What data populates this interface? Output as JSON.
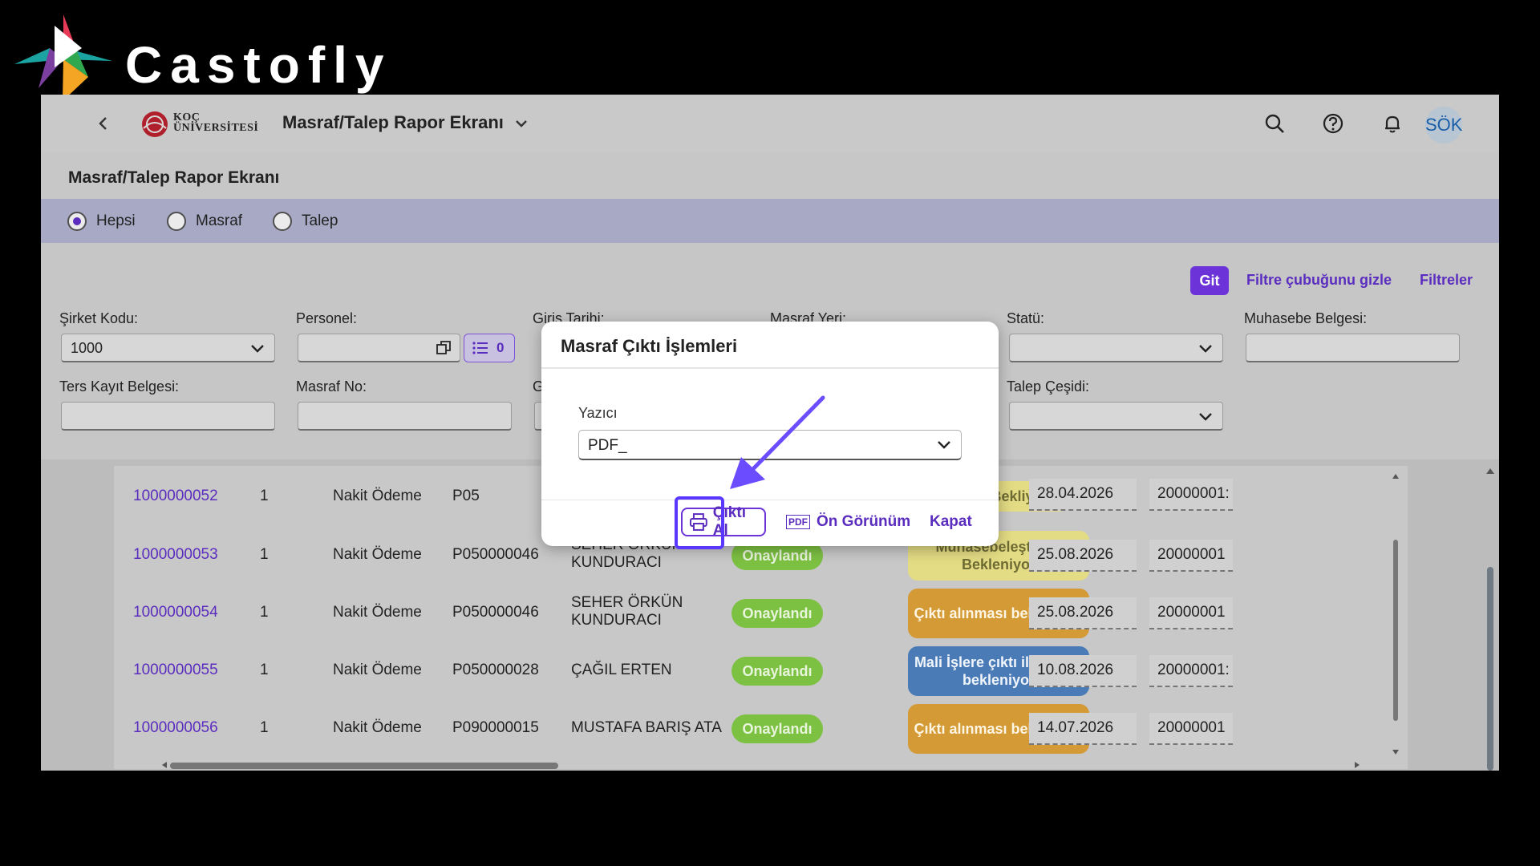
{
  "brand": {
    "name": "Castofly"
  },
  "shell": {
    "logo_line1": "KOÇ",
    "logo_line2": "ÜNİVERSİTESİ",
    "app_title": "Masraf/Talep Rapor Ekranı",
    "avatar": "SÖK",
    "icons": [
      "chevron-left-icon",
      "search-icon",
      "help-icon",
      "bell-icon"
    ]
  },
  "page": {
    "title": "Masraf/Talep Rapor Ekranı"
  },
  "radio": {
    "options": [
      {
        "label": "Hepsi",
        "selected": true
      },
      {
        "label": "Masraf",
        "selected": false
      },
      {
        "label": "Talep",
        "selected": false
      }
    ]
  },
  "filterbar": {
    "go": "Git",
    "hide": "Filtre çubuğunu gizle",
    "filters": "Filtreler",
    "fields": {
      "sirket_kodu": {
        "label": "Şirket Kodu:",
        "value": "1000"
      },
      "personel": {
        "label": "Personel:",
        "count": "0"
      },
      "giris_tarihi": {
        "label": "Giris Tarihi:"
      },
      "masraf_yeri": {
        "label": "Masraf Yeri:"
      },
      "statu": {
        "label": "Statü:"
      },
      "muhasebe_belgesi": {
        "label": "Muhasebe Belgesi:"
      },
      "ters_kayit": {
        "label": "Ters Kayıt Belgesi:"
      },
      "masraf_no": {
        "label": "Masraf No:"
      },
      "g_partial": {
        "label": "G"
      },
      "talep_cesidi": {
        "label": "Talep Çeşidi:"
      }
    }
  },
  "table": {
    "rows": [
      {
        "no": "1000000052",
        "qty": "1",
        "type": "Nakit Ödeme",
        "pcode": "P05",
        "name": "",
        "approval": "",
        "status": "Onay Bekliyor",
        "status_color": "yellow",
        "date": "28.04.2026",
        "doc": "20000001:"
      },
      {
        "no": "1000000053",
        "qty": "1",
        "type": "Nakit Ödeme",
        "pcode": "P050000046",
        "name": "SEHER ÖRKÜN KUNDURACI",
        "approval": "Onaylandı",
        "status": "Muhasebeleştirme Bekleniyor",
        "status_color": "yellow",
        "date": "25.08.2026",
        "doc": "20000001"
      },
      {
        "no": "1000000054",
        "qty": "1",
        "type": "Nakit Ödeme",
        "pcode": "P050000046",
        "name": "SEHER ÖRKÜN KUNDURACI",
        "approval": "Onaylandı",
        "status": "Çıktı alınması bekleniyor",
        "status_color": "orange",
        "date": "25.08.2026",
        "doc": "20000001"
      },
      {
        "no": "1000000055",
        "qty": "1",
        "type": "Nakit Ödeme",
        "pcode": "P050000028",
        "name": "ÇAĞIL ERTEN",
        "approval": "Onaylandı",
        "status": "Mali İşlere çıktı iletilmesi bekleniyor",
        "status_color": "blue",
        "date": "10.08.2026",
        "doc": "20000001:"
      },
      {
        "no": "1000000056",
        "qty": "1",
        "type": "Nakit Ödeme",
        "pcode": "P090000015",
        "name": "MUSTAFA BARIŞ ATA",
        "approval": "Onaylandı",
        "status": "Çıktı alınması bekleniyor",
        "status_color": "orange",
        "date": "14.07.2026",
        "doc": "20000001"
      }
    ]
  },
  "dialog": {
    "title": "Masraf Çıktı İşlemleri",
    "printer_label": "Yazıcı",
    "printer_value": "PDF_",
    "print": "Çıktı Al",
    "preview": "Ön Görünüm",
    "close": "Kapat",
    "pdf_glyph": "PDF"
  },
  "colors": {
    "accent": "#6b33d8",
    "link": "#5b2dbf",
    "highlight": "#5a38ff"
  }
}
